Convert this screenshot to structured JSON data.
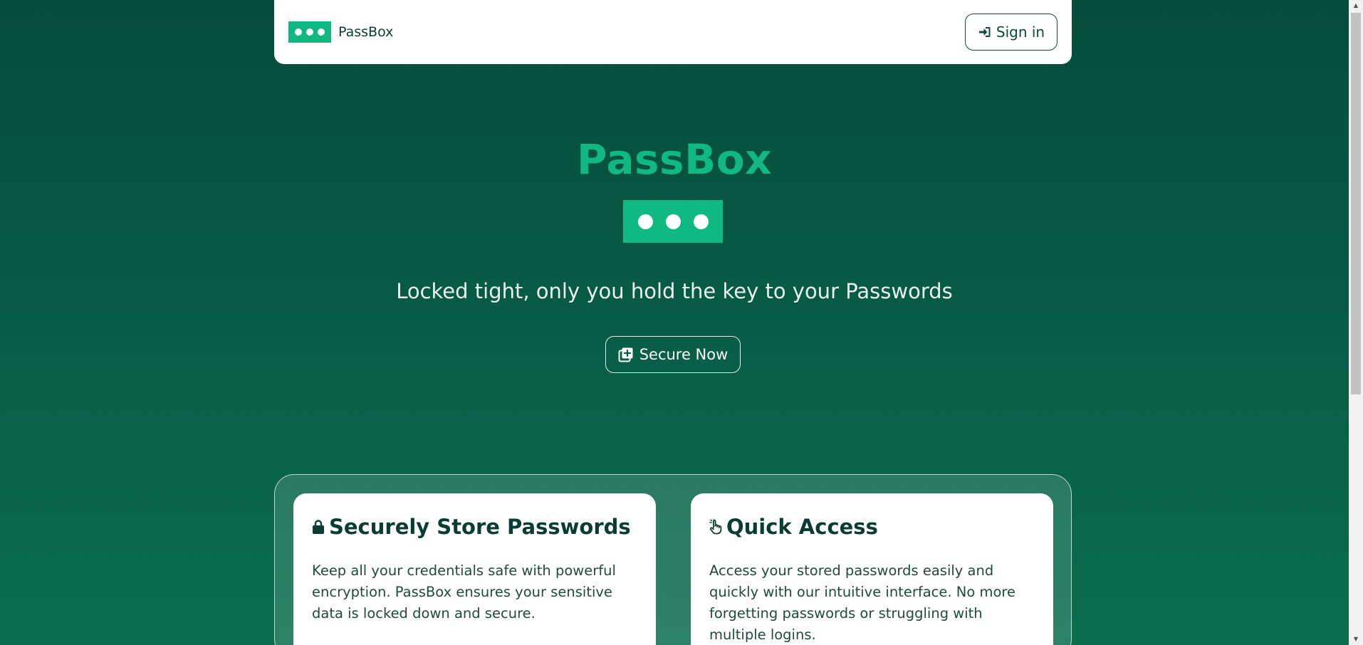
{
  "navbar": {
    "brand_name": "PassBox",
    "signin_label": "Sign in"
  },
  "hero": {
    "title": "PassBox",
    "tagline": "Locked tight, only you hold the key to your Passwords",
    "cta_label": "Secure Now"
  },
  "features": [
    {
      "icon": "lock-icon",
      "title": "Securely Store Passwords",
      "text": "Keep all your credentials safe with powerful encryption. PassBox ensures your sensitive data is locked down and secure."
    },
    {
      "icon": "pointer-hand-icon",
      "title": "Quick Access",
      "text": "Access your stored passwords easily and quickly with our intuitive interface. No more forgetting passwords or struggling with multiple logins."
    }
  ],
  "colors": {
    "brand_green": "#10b981",
    "dark_green": "#064c3b",
    "text_dark": "#0a3d31"
  }
}
